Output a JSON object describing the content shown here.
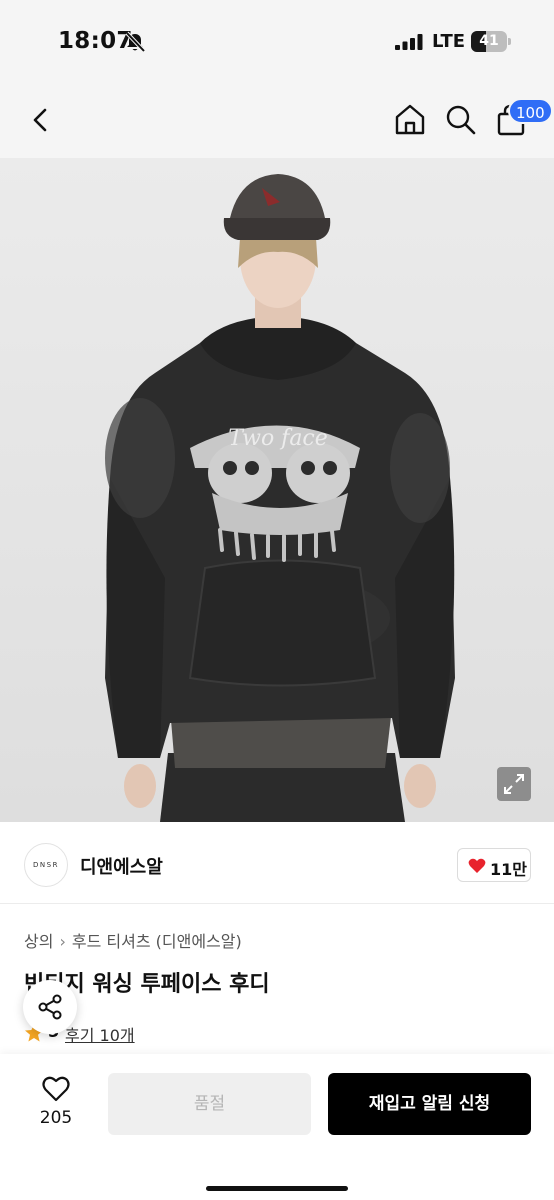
{
  "status_bar": {
    "time": "18:07",
    "network": "LTE",
    "battery": "41",
    "battery_level": 0.41
  },
  "topnav": {
    "cart_badge": "100"
  },
  "brand": {
    "logo_text": "DNSR",
    "name": "디앤에스알",
    "likes": "11만"
  },
  "breadcrumb": {
    "items": [
      "상의",
      "후드 티셔츠 (디앤에스알)"
    ]
  },
  "product": {
    "title": "빈티지 워싱 투페이스 후디",
    "rating": "5",
    "reviews": "후기 10개",
    "image_print_text": "Two face"
  },
  "bottom_bar": {
    "wish_count": "205",
    "soldout_label": "품절",
    "restock_label": "재입고 알림 신청"
  },
  "colors": {
    "accent_blue": "#2f6df6",
    "heart_red": "#e8232d",
    "star_orange": "#f5a623"
  }
}
